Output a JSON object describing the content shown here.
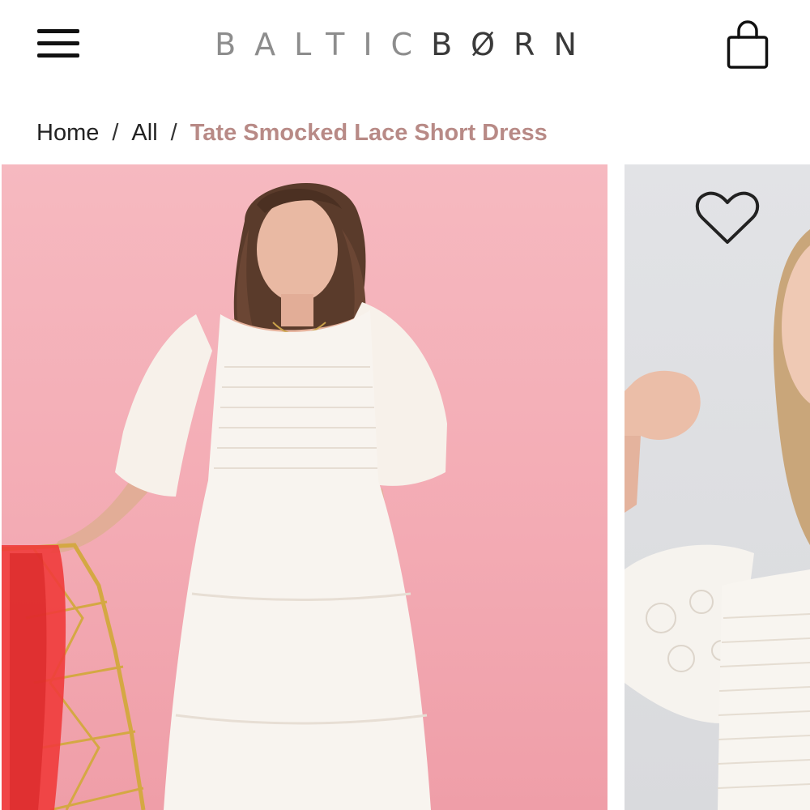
{
  "header": {
    "menu_icon": "hamburger-menu-icon",
    "logo": {
      "part_light": "BALTIC",
      "part_dark": "BØRN"
    },
    "cart_icon": "shopping-bag-icon"
  },
  "breadcrumb": {
    "items": [
      "Home",
      "All"
    ],
    "separator": "/",
    "current": "Tate Smocked Lace Short Dress"
  },
  "gallery": {
    "favorite_icon": "heart-icon",
    "images": [
      {
        "name": "product-photo-main"
      },
      {
        "name": "product-photo-secondary"
      }
    ]
  },
  "colors": {
    "accent": "#b88a86",
    "photo_1_background": "#f3aab3",
    "photo_2_background": "#dcdde0"
  }
}
